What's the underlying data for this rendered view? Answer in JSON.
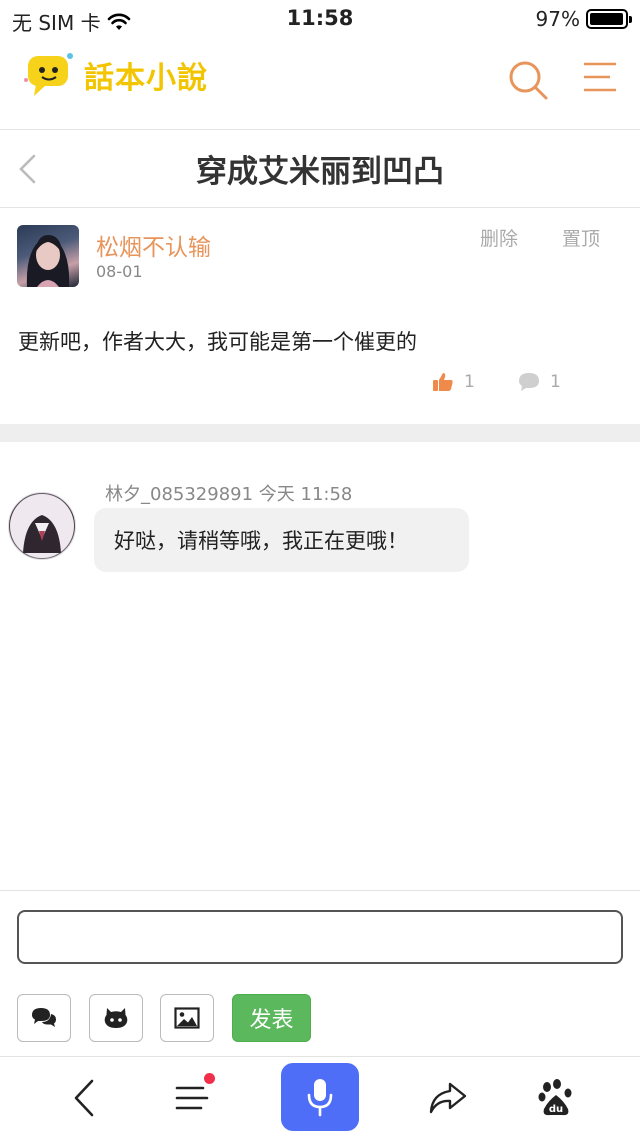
{
  "status": {
    "carrier": "无 SIM 卡",
    "time": "11:58",
    "battery_text": "97%",
    "battery_level": 0.97
  },
  "site": {
    "logo_text": "話本小說"
  },
  "page": {
    "title": "穿成艾米丽到凹凸"
  },
  "post": {
    "author": "松烟不认输",
    "date": "08-01",
    "delete_label": "删除",
    "pin_label": "置顶",
    "content": "更新吧，作者大大，我可能是第一个催更的",
    "likes": "1",
    "replies": "1"
  },
  "comment": {
    "meta": "林夕_085329891 今天 11:58",
    "text": "好哒，请稍等哦，我正在更哦！"
  },
  "composer": {
    "input_value": "",
    "input_placeholder": "",
    "send_label": "发表"
  },
  "colors": {
    "accent": "#e8955c",
    "send_green": "#5cb85c",
    "mic_blue": "#4f6ef7",
    "logo_yellow": "#f2c500"
  }
}
